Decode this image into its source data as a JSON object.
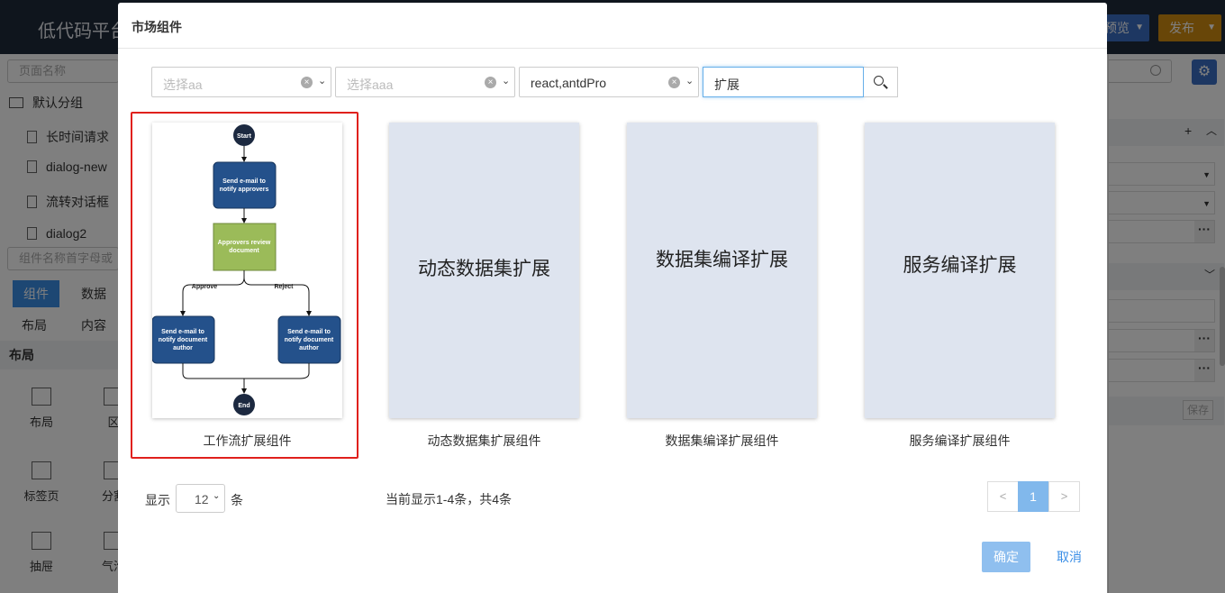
{
  "app": {
    "title": "低代码平台",
    "preview_label": "预览",
    "publish_label": "发布"
  },
  "left_panel": {
    "page_search_placeholder": "页面名称",
    "group_name": "默认分组",
    "pages": [
      "长时间请求",
      "dialog-new",
      "流转对话框",
      "dialog2"
    ],
    "component_search_placeholder": "组件名称首字母或",
    "tabs": [
      "组件",
      "数据"
    ],
    "sub_tabs": [
      "布局",
      "内容"
    ],
    "section_title": "布局",
    "components": [
      "布局",
      "区",
      "标签页",
      "分割",
      "抽屉",
      "气泡"
    ]
  },
  "right_panel": {
    "save_label": "保存",
    "add_symbol": "+",
    "dots_symbol": "···"
  },
  "modal": {
    "title": "市场组件",
    "filters": [
      {
        "placeholder": "选择aa",
        "value": ""
      },
      {
        "placeholder": "选择aaa",
        "value": ""
      },
      {
        "placeholder": "",
        "value": "react,antdPro"
      }
    ],
    "keyword": "扩展",
    "cards": [
      {
        "name": "工作流扩展组件",
        "thumb_title": ""
      },
      {
        "name": "动态数据集扩展组件",
        "thumb_title": "动态数据集扩展"
      },
      {
        "name": "数据集编译扩展组件",
        "thumb_title": "数据集编译扩展"
      },
      {
        "name": "服务编译扩展组件",
        "thumb_title": "服务编译扩展"
      }
    ],
    "workflow": {
      "start": "Start",
      "step1_line1": "Send e-mail to",
      "step1_line2": "notify approvers",
      "step2_line1": "Approvers review",
      "step2_line2": "document",
      "approve": "Approve",
      "reject": "Reject",
      "left_line1": "Send e-mail to",
      "left_line2": "notify document",
      "left_line3": "author",
      "right_line1": "Send e-mail to",
      "right_line2": "notify document",
      "right_line3": "author",
      "end": "End"
    },
    "pagination": {
      "show_label": "显示",
      "page_size": "12",
      "unit_label": "条",
      "info": "当前显示1-4条，共4条",
      "prev": "<",
      "current": "1",
      "next": ">"
    },
    "ok_label": "确定",
    "cancel_label": "取消"
  },
  "colors": {
    "accent": "#3a8ee6",
    "highlight": "#e0201c",
    "flow_blue": "#24518b",
    "flow_green": "#9bbb59"
  }
}
